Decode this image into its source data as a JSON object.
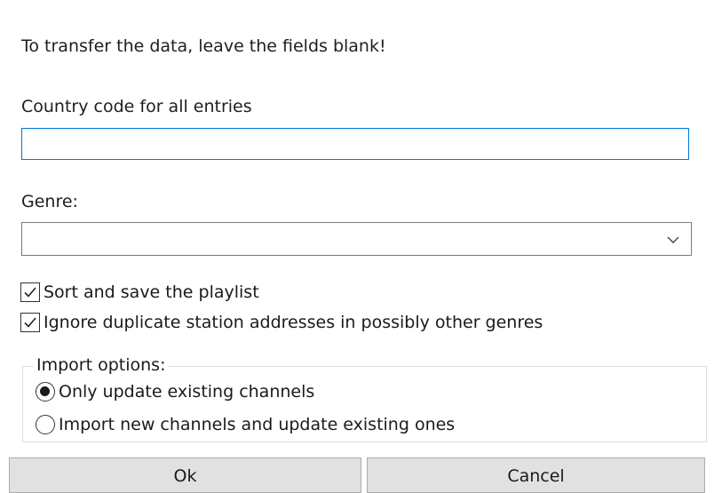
{
  "dialog": {
    "intro_text": "To transfer the data, leave the fields blank!",
    "country_code": {
      "label": "Country code for all entries",
      "value": "",
      "placeholder": ""
    },
    "genre": {
      "label": "Genre:",
      "selected": "",
      "icon": "chevron-down-icon"
    },
    "checkboxes": [
      {
        "label": "Sort and save the playlist",
        "checked": true
      },
      {
        "label": "Ignore duplicate station addresses in possibly other genres",
        "checked": true
      }
    ],
    "import_options": {
      "title": "Import options:",
      "options": [
        {
          "label": "Only update existing channels",
          "selected": true
        },
        {
          "label": "Import new channels and update existing ones",
          "selected": false
        }
      ]
    },
    "buttons": {
      "ok": "Ok",
      "cancel": "Cancel"
    }
  },
  "colors": {
    "focus_border": "#0078d7",
    "button_face": "#e1e1e1",
    "button_border": "#adadad",
    "group_border": "#dcdcdc"
  }
}
